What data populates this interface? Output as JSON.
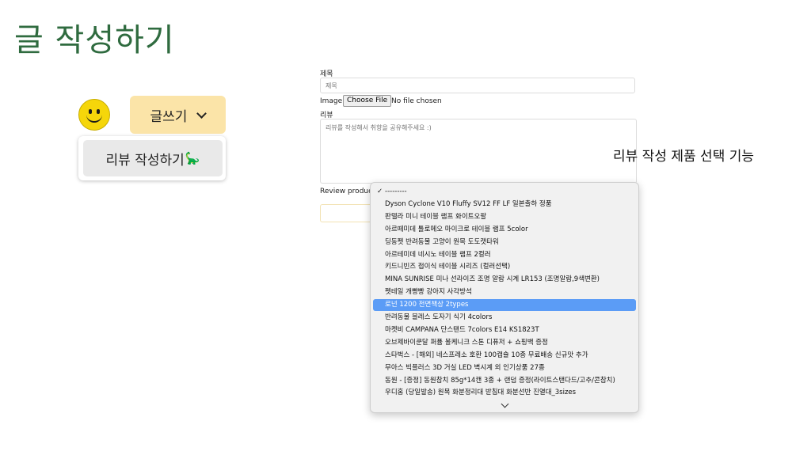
{
  "page": {
    "title": "글 작성하기"
  },
  "menu": {
    "write_label": "글쓰기",
    "items": [
      {
        "label": "리뷰 작성하기",
        "emoji": "🦕"
      }
    ]
  },
  "form": {
    "title_label": "제목",
    "title_placeholder": "제목",
    "image_label": "Image:",
    "file_button": "Choose File",
    "file_status": "No file chosen",
    "review_label": "리뷰",
    "review_placeholder": "리뷰를 작성해서 취향을 공유해주세요 :)",
    "product_label": "Review product"
  },
  "annotation": "리뷰 작성 제품 선택 기능",
  "select": {
    "selected_index": 9,
    "checked_index": 0,
    "options": [
      "---------",
      "Dyson Cyclone V10 Fluffy SV12 FF LF 일본출하 정품",
      "판텔라 미니 테이블 램프 화이트오팔",
      "아르떼미데 톨로메오 마이크로 테이블 램프 5color",
      "딩동펫 반려동물 고양이 원목 도도캣타워",
      "아르테미데 네시노 테이블 램프 2컬러",
      "키드니빈즈 접이식 테이블 시리즈 (컬러선택)",
      "MINA SUNRISE 미나 선라이즈 조명 알람 시계 LR153 (조명알람,9색변환)",
      "펫테일 개빵빵 강아지 사각방석",
      "로넌 1200 전면책상 2types",
      "반려동물 블레스 도자기 식기 4colors",
      "마켓비 CAMPANA 단스탠드 7colors E14 KS1823T",
      "오브제바이쿤달 퍼퓸 볼케니크 스톤 디퓨저 + 쇼핑백 증정",
      "스타벅스 - [해외] 네스프레소 호환 100캡슐 10종 무료배송 신규맛 추가",
      "무아스 빅플러스 3D 거실 LED 벽시계 외 인기상품 27종",
      "동원 - [증정] 동원참치 85g*14캔 3종 + 랜덤 증정(라이트스탠다드/고추/콘참치)",
      "우디홈 (당일발송) 원목 화분정리대 받침대 화분선반 진열대_3sizes"
    ]
  }
}
